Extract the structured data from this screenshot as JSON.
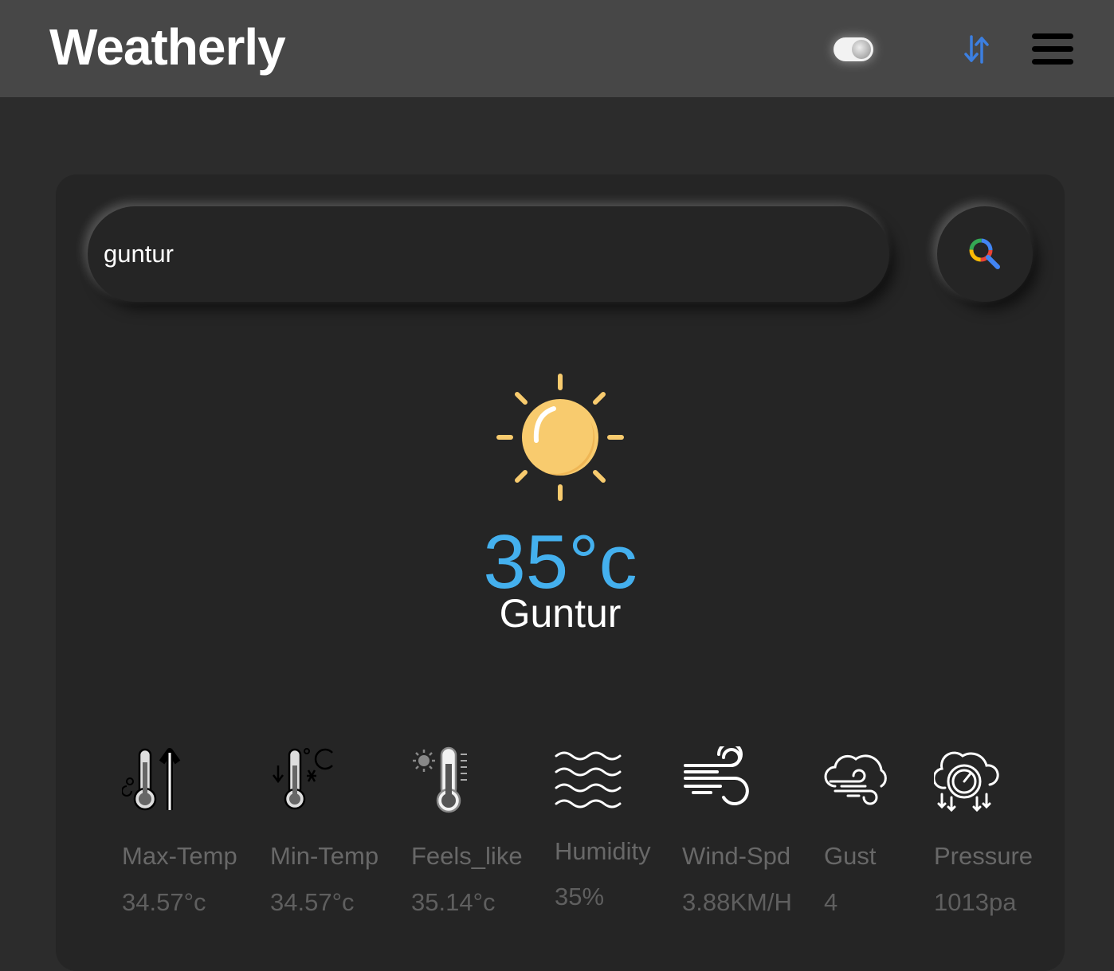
{
  "header": {
    "brand": "Weatherly",
    "theme_toggle_icon": "toggle-switch-icon",
    "sort_icon": "sort-arrows-icon",
    "menu_icon": "hamburger-menu-icon"
  },
  "search": {
    "value": "guntur",
    "button_icon": "search-icon"
  },
  "current": {
    "icon": "sun-icon",
    "temperature": "35°c",
    "city": "Guntur"
  },
  "stats": [
    {
      "icon": "thermometer-max-icon",
      "label": "Max-Temp",
      "value": "34.57°c"
    },
    {
      "icon": "thermometer-min-icon",
      "label": "Min-Temp",
      "value": "34.57°c"
    },
    {
      "icon": "thermometer-feels-icon",
      "label": "Feels_like",
      "value": "35.14°c"
    },
    {
      "icon": "humidity-waves-icon",
      "label": "Humidity",
      "value": "35%"
    },
    {
      "icon": "wind-icon",
      "label": "Wind-Spd",
      "value": "3.88KM/H"
    },
    {
      "icon": "gust-cloud-icon",
      "label": "Gust",
      "value": "4"
    },
    {
      "icon": "pressure-gauge-icon",
      "label": "Pressure",
      "value": "1013pa"
    }
  ],
  "colors": {
    "header_bg": "#474747",
    "page_bg": "#2c2c2c",
    "card_bg": "#252525",
    "temperature": "#44b0ee",
    "sun": "#f8cb6e",
    "sort_icon": "#3c7fe0"
  }
}
